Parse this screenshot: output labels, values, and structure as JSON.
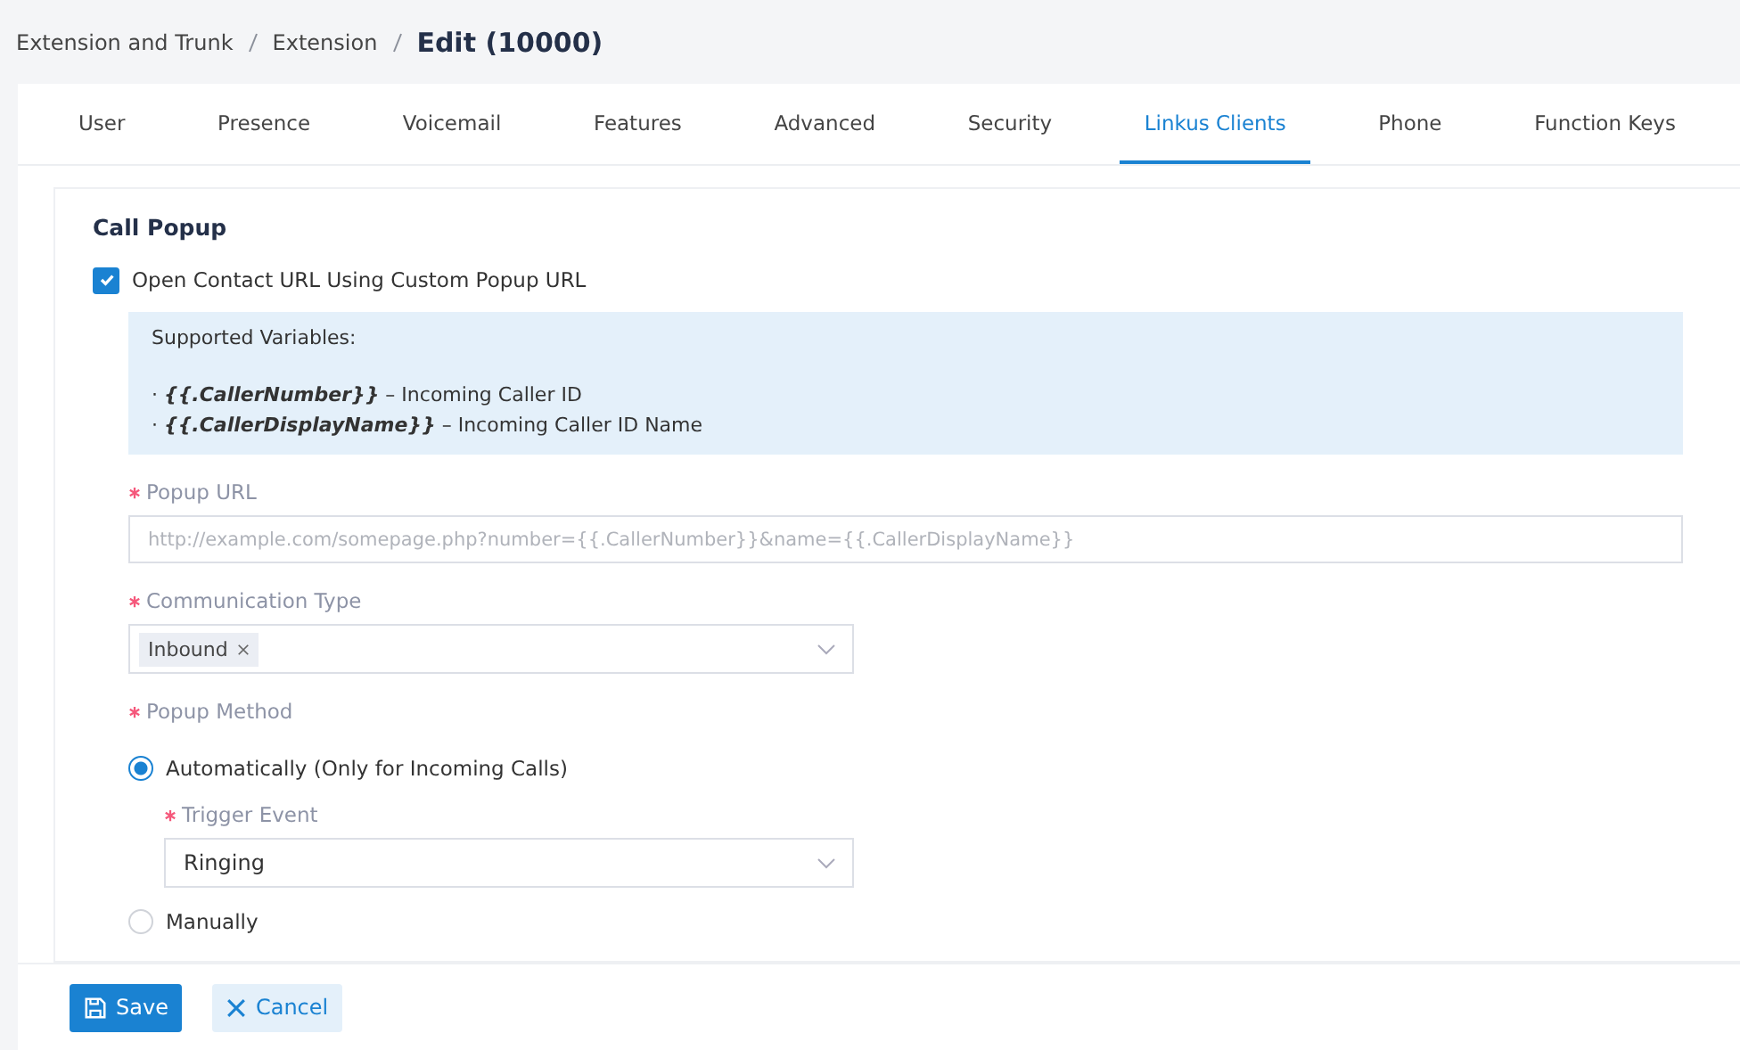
{
  "breadcrumb": {
    "items": [
      "Extension and Trunk",
      "Extension"
    ],
    "current": "Edit (10000)"
  },
  "tabs": [
    {
      "label": "User",
      "selected": false
    },
    {
      "label": "Presence",
      "selected": false
    },
    {
      "label": "Voicemail",
      "selected": false
    },
    {
      "label": "Features",
      "selected": false
    },
    {
      "label": "Advanced",
      "selected": false
    },
    {
      "label": "Security",
      "selected": false
    },
    {
      "label": "Linkus Clients",
      "selected": true
    },
    {
      "label": "Phone",
      "selected": false
    },
    {
      "label": "Function Keys",
      "selected": false
    }
  ],
  "section": {
    "title": "Call Popup",
    "open_contact_url": {
      "label": "Open Contact URL Using Custom Popup URL",
      "checked": true
    },
    "info": {
      "title": "Supported Variables:",
      "lines": [
        "· **{{.CallerNumber}}** – Incoming Caller ID",
        "· **{{.CallerDisplayName}}** – Incoming Caller ID Name"
      ]
    },
    "popup_url": {
      "label": "Popup URL",
      "required": true,
      "placeholder": "http://example.com/somepage.php?number={{.CallerNumber}}&name={{.CallerDisplayName}}"
    },
    "communication_type": {
      "label": "Communication Type",
      "required": true,
      "tags": [
        "Inbound"
      ]
    },
    "popup_method": {
      "label": "Popup Method",
      "required": true,
      "options": [
        {
          "label": "Automatically (Only for Incoming Calls)",
          "selected": true,
          "trigger_event": {
            "label": "Trigger Event",
            "required": true,
            "value": "Ringing"
          }
        },
        {
          "label": "Manually",
          "selected": false
        }
      ]
    }
  },
  "buttons": {
    "save": "Save",
    "cancel": "Cancel"
  }
}
